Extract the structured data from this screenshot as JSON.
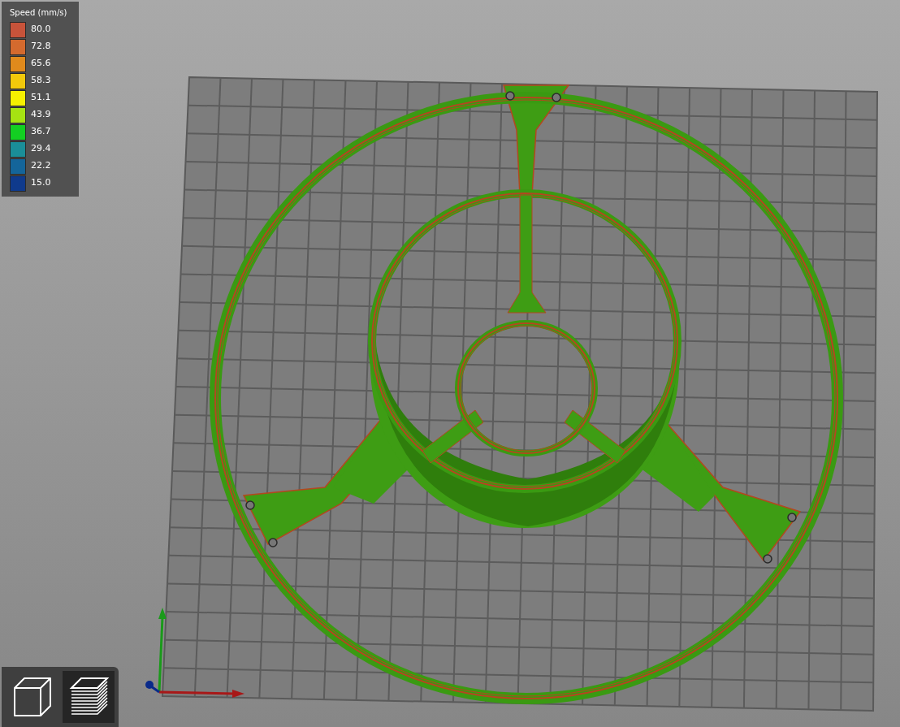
{
  "legend": {
    "title": "Speed (mm/s)",
    "items": [
      {
        "label": "80.0",
        "color": "#c8533a"
      },
      {
        "label": "72.8",
        "color": "#d46a2e"
      },
      {
        "label": "65.6",
        "color": "#e08a1c"
      },
      {
        "label": "58.3",
        "color": "#f2c90b"
      },
      {
        "label": "51.1",
        "color": "#f5f000"
      },
      {
        "label": "43.9",
        "color": "#a6e312"
      },
      {
        "label": "36.7",
        "color": "#13cf22"
      },
      {
        "label": "29.4",
        "color": "#1a8e98"
      },
      {
        "label": "22.2",
        "color": "#14659a"
      },
      {
        "label": "15.0",
        "color": "#0f3a8c"
      }
    ]
  },
  "view_buttons": [
    {
      "kind": "cube",
      "selected": false
    },
    {
      "kind": "layers",
      "selected": true
    }
  ]
}
